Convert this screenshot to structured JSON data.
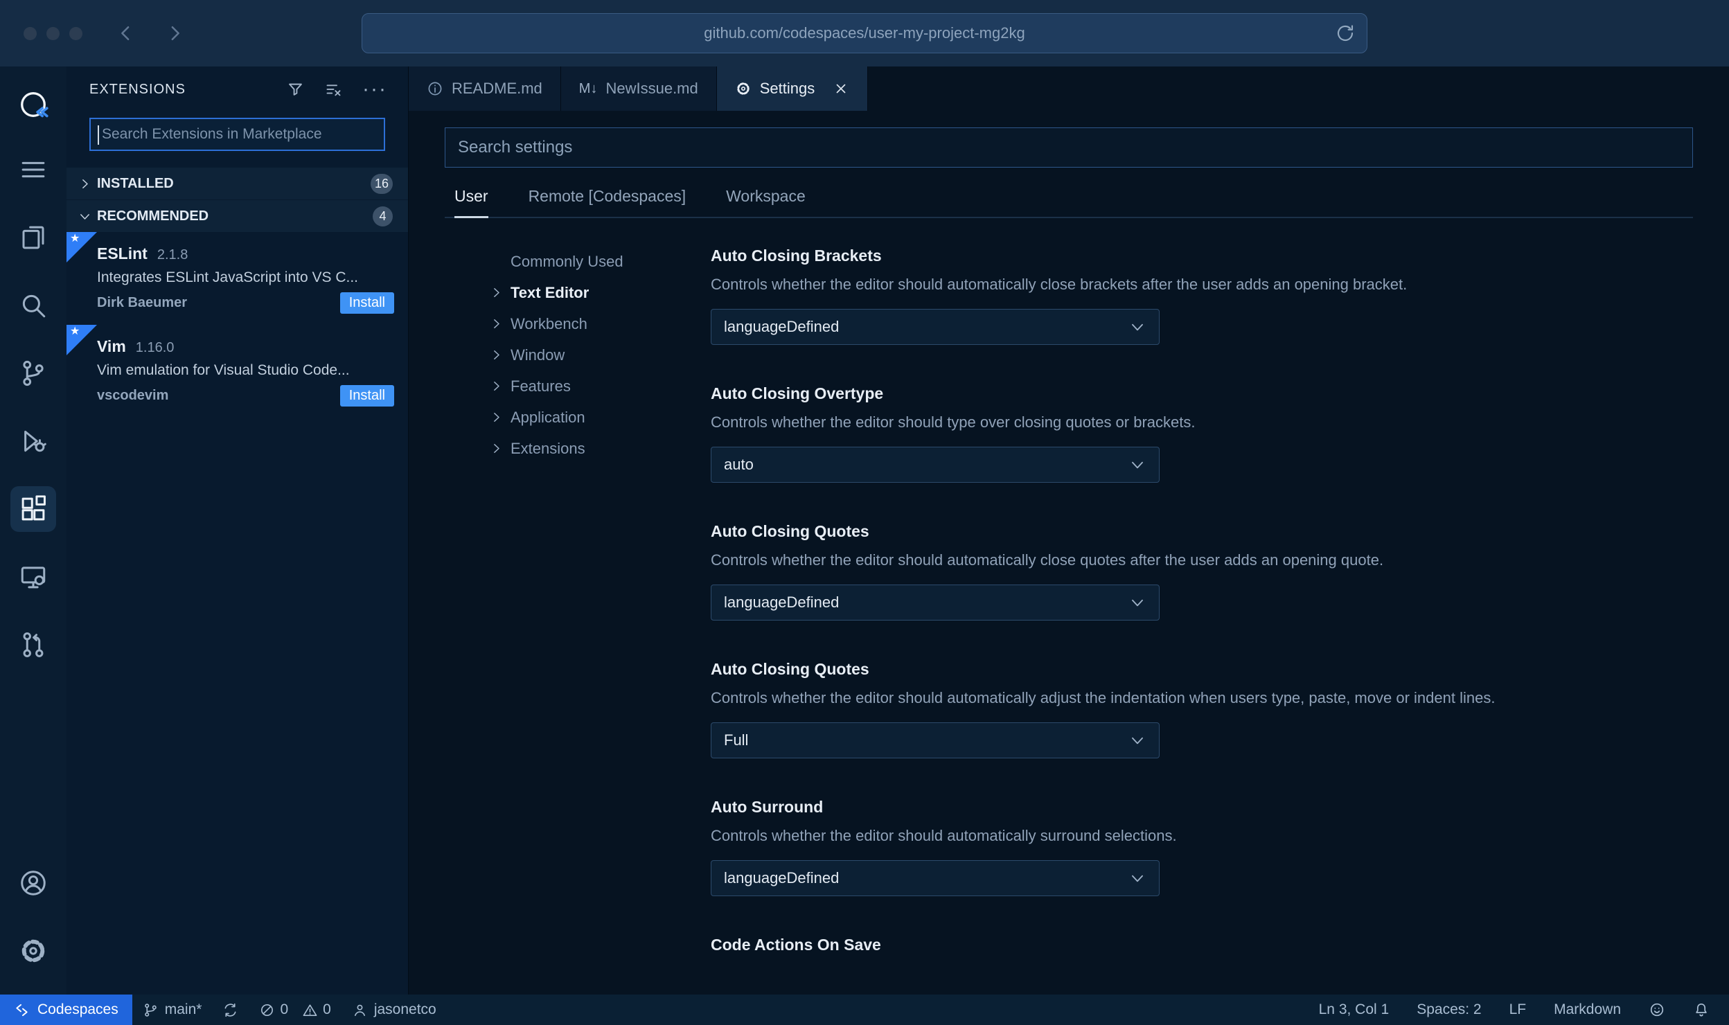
{
  "colors": {
    "accent_blue": "#2f7ef7",
    "status_blue": "#2065dc",
    "install_button": "#3f93f5",
    "editor_bg": "#061321",
    "sidebar_bg": "#081a2e",
    "chrome_bg": "#152c45"
  },
  "chrome": {
    "url": "github.com/codespaces/user-my-project-mg2kg"
  },
  "sidebar": {
    "title": "EXTENSIONS",
    "search_placeholder": "Search Extensions in Marketplace",
    "sections": [
      {
        "label": "INSTALLED",
        "count": "16"
      },
      {
        "label": "RECOMMENDED",
        "count": "4"
      }
    ],
    "extensions": [
      {
        "name": "ESLint",
        "version": "2.1.8",
        "description": "Integrates ESLint JavaScript into VS C...",
        "author": "Dirk Baeumer",
        "action": "Install"
      },
      {
        "name": "Vim",
        "version": "1.16.0",
        "description": "Vim emulation for Visual Studio Code...",
        "author": "vscodevim",
        "action": "Install"
      }
    ]
  },
  "tabs": [
    {
      "label": "README.md"
    },
    {
      "label": "NewIssue.md"
    },
    {
      "label": "Settings"
    }
  ],
  "settings": {
    "search_placeholder": "Search settings",
    "scopes": [
      "User",
      "Remote [Codespaces]",
      "Workspace"
    ],
    "toc": [
      "Commonly Used",
      "Text Editor",
      "Workbench",
      "Window",
      "Features",
      "Application",
      "Extensions"
    ],
    "items": [
      {
        "title": "Auto Closing Brackets",
        "description": "Controls whether the editor should automatically close brackets after the user adds an opening bracket.",
        "value": "languageDefined"
      },
      {
        "title": "Auto Closing Overtype",
        "description": "Controls whether the editor should type over closing quotes or brackets.",
        "value": "auto"
      },
      {
        "title": "Auto Closing Quotes",
        "description": "Controls whether the editor should automatically close quotes after the user adds an opening quote.",
        "value": "languageDefined"
      },
      {
        "title": "Auto Closing Quotes",
        "description": "Controls whether the editor should automatically adjust the indentation when users type, paste, move or indent lines.",
        "value": "Full"
      },
      {
        "title": "Auto Surround",
        "description": "Controls whether the editor should automatically surround selections.",
        "value": "languageDefined"
      },
      {
        "title": "Code Actions On Save"
      }
    ]
  },
  "status_bar": {
    "remote_label": "Codespaces",
    "branch": "main*",
    "errors": "0",
    "warnings": "0",
    "user": "jasonetco",
    "cursor": "Ln 3, Col 1",
    "indent": "Spaces: 2",
    "eol": "LF",
    "language": "Markdown"
  },
  "icons": {
    "ellipsis": "···",
    "markdown": "M↓",
    "star": "★"
  }
}
